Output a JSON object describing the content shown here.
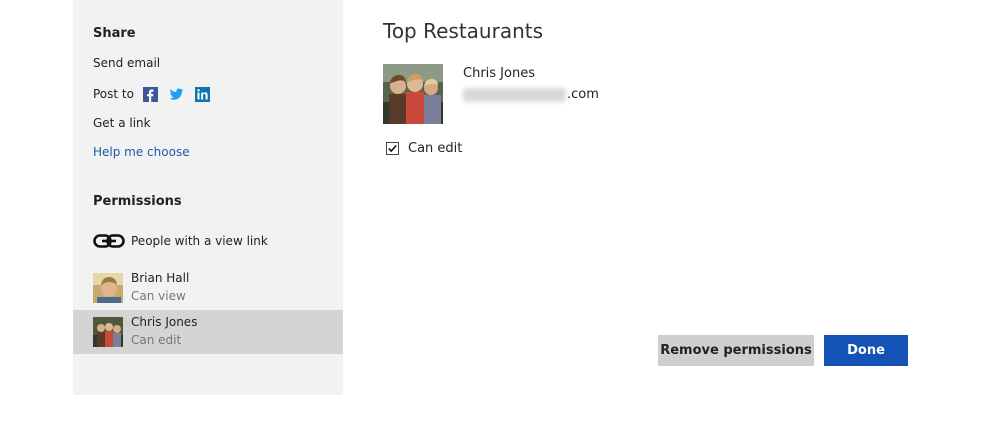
{
  "sidebar": {
    "share_title": "Share",
    "send_email": "Send email",
    "post_to": "Post to",
    "social_icons": [
      "facebook-icon",
      "twitter-icon",
      "linkedin-icon"
    ],
    "get_link": "Get a link",
    "help_me_choose": "Help me choose",
    "permissions_title": "Permissions",
    "view_link_label": "People with a view link",
    "people": [
      {
        "name": "Brian Hall",
        "role": "Can view",
        "selected": false
      },
      {
        "name": "Chris Jones",
        "role": "Can edit",
        "selected": true
      }
    ]
  },
  "main": {
    "title": "Top Restaurants",
    "user_name": "Chris Jones",
    "email_domain": ".com",
    "can_edit_label": "Can edit",
    "can_edit_checked": true
  },
  "buttons": {
    "remove_label": "Remove permissions",
    "done_label": "Done"
  },
  "colors": {
    "accent": "#1552b5",
    "link": "#1e5aa8",
    "sidebar_bg": "#f2f2f2",
    "selected_row": "#d4d4d4"
  }
}
